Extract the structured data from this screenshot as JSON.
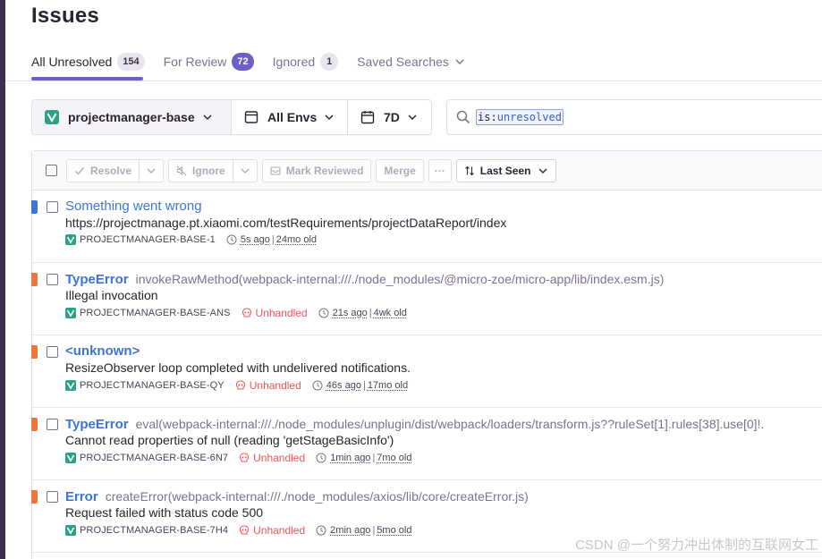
{
  "page": {
    "title": "Issues"
  },
  "tabs": [
    {
      "label": "All Unresolved",
      "count": "154"
    },
    {
      "label": "For Review",
      "count": "72"
    },
    {
      "label": "Ignored",
      "count": "1"
    },
    {
      "label": "Saved Searches"
    }
  ],
  "filters": {
    "project": "projectmanager-base",
    "environment": "All Envs",
    "date_range": "7D"
  },
  "search": {
    "key": "is:",
    "value": "unresolved"
  },
  "toolbar": {
    "resolve": "Resolve",
    "ignore": "Ignore",
    "mark_reviewed": "Mark Reviewed",
    "merge": "Merge",
    "more": "···",
    "sort": "Last Seen"
  },
  "issues": [
    {
      "level": "info",
      "type": "Something went wrong",
      "location": "",
      "message": "https://projectmanage.pt.xiaomi.com/testRequirements/projectDataReport/index",
      "short_id": "PROJECTMANAGER-BASE-1",
      "unhandled": "",
      "last_seen": "5s ago",
      "age": "24mo old"
    },
    {
      "level": "error",
      "type": "TypeError",
      "location": "invokeRawMethod(webpack-internal:///./node_modules/@micro-zoe/micro-app/lib/index.esm.js)",
      "message": "Illegal invocation",
      "short_id": "PROJECTMANAGER-BASE-ANS",
      "unhandled": "Unhandled",
      "last_seen": "21s ago",
      "age": "4wk old"
    },
    {
      "level": "error",
      "type": "<unknown>",
      "location": "",
      "message": "ResizeObserver loop completed with undelivered notifications.",
      "short_id": "PROJECTMANAGER-BASE-QY",
      "unhandled": "Unhandled",
      "last_seen": "46s ago",
      "age": "17mo old"
    },
    {
      "level": "error",
      "type": "TypeError",
      "location": "eval(webpack-internal:///./node_modules/unplugin/dist/webpack/loaders/transform.js??ruleSet[1].rules[38].use[0]!.",
      "message": "Cannot read properties of null (reading 'getStageBasicInfo')",
      "short_id": "PROJECTMANAGER-BASE-6N7",
      "unhandled": "Unhandled",
      "last_seen": "1min ago",
      "age": "7mo old"
    },
    {
      "level": "error",
      "type": "Error",
      "location": "createError(webpack-internal:///./node_modules/axios/lib/core/createError.js)",
      "message": "Request failed with status code 500",
      "short_id": "PROJECTMANAGER-BASE-7H4",
      "unhandled": "Unhandled",
      "last_seen": "2min ago",
      "age": "5mo old"
    }
  ],
  "watermark": "CSDN @一个努力冲出体制的互联网女工",
  "colors": {
    "accent": "#6c5fc7",
    "link": "#3d74db",
    "error_level": "#f2763b",
    "info_level": "#3d74db",
    "unhandled": "#f55459",
    "project_logo": "#2ba185"
  }
}
